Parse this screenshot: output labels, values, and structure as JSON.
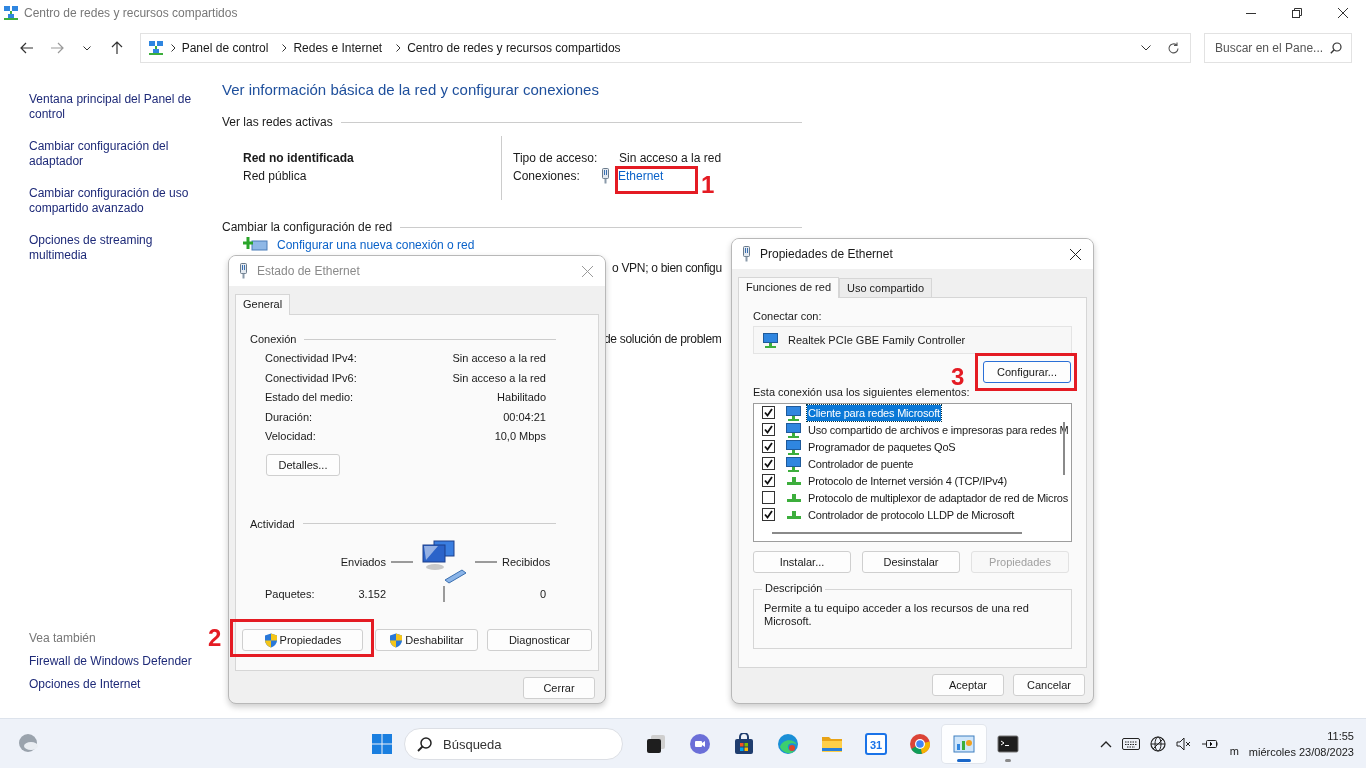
{
  "window": {
    "title": "Centro de redes y recursos compartidos"
  },
  "address_bar": {
    "breadcrumbs": [
      "Panel de control",
      "Redes e Internet",
      "Centro de redes y recursos compartidos"
    ]
  },
  "search": {
    "placeholder": "Buscar en el Pane..."
  },
  "sidebar": {
    "links": [
      "Ventana principal del Panel de control",
      "Cambiar configuración del adaptador",
      "Cambiar configuración de uso compartido avanzado",
      "Opciones de streaming multimedia"
    ],
    "see_also_title": "Vea también",
    "see_also": [
      "Firewall de Windows Defender",
      "Opciones de Internet"
    ]
  },
  "main": {
    "heading": "Ver información básica de la red y configurar conexiones",
    "active_networks_title": "Ver las redes activas",
    "network": {
      "name": "Red no identificada",
      "category": "Red pública",
      "access_label": "Tipo de acceso:",
      "access_value": "Sin acceso a la red",
      "connections_label": "Conexiones:",
      "connection_link": "Ethernet"
    },
    "change_title": "Cambiar la configuración de red",
    "setup_link": "Configurar una nueva conexión o red",
    "covered_fragments": [
      "o VPN; o bien configu",
      "de solución de problem"
    ]
  },
  "status_dialog": {
    "title": "Estado de Ethernet",
    "tabs": [
      {
        "label": "General",
        "selected": true
      }
    ],
    "connection_title": "Conexión",
    "rows": [
      {
        "label": "Conectividad IPv4:",
        "value": "Sin acceso a la red"
      },
      {
        "label": "Conectividad IPv6:",
        "value": "Sin acceso a la red"
      },
      {
        "label": "Estado del medio:",
        "value": "Habilitado"
      },
      {
        "label": "Duración:",
        "value": "00:04:21"
      },
      {
        "label": "Velocidad:",
        "value": "10,0 Mbps"
      }
    ],
    "details_button": "Detalles...",
    "activity_title": "Actividad",
    "sent_label": "Enviados",
    "received_label": "Recibidos",
    "packets_label": "Paquetes:",
    "packets_sent": "3.152",
    "packets_received": "0",
    "buttons": [
      {
        "label": "Propiedades",
        "shield": true
      },
      {
        "label": "Deshabilitar",
        "shield": true
      },
      {
        "label": "Diagnosticar",
        "shield": false
      }
    ],
    "close_button": "Cerrar"
  },
  "properties_dialog": {
    "title": "Propiedades de Ethernet",
    "tabs": [
      {
        "label": "Funciones de red",
        "selected": true
      },
      {
        "label": "Uso compartido",
        "selected": false
      }
    ],
    "connect_label": "Conectar con:",
    "adapter": "Realtek PCIe GBE Family Controller",
    "configure_button": "Configurar...",
    "components_label": "Esta conexión usa los siguientes elementos:",
    "components": [
      {
        "kind": "client",
        "label": "Cliente para redes Microsoft",
        "checked": true,
        "selected": true
      },
      {
        "kind": "service",
        "label": "Uso compartido de archivos e impresoras para redes M",
        "checked": true,
        "selected": false
      },
      {
        "kind": "service",
        "label": "Programador de paquetes QoS",
        "checked": true,
        "selected": false
      },
      {
        "kind": "service",
        "label": "Controlador de puente",
        "checked": true,
        "selected": false
      },
      {
        "kind": "protocol",
        "label": "Protocolo de Internet versión 4 (TCP/IPv4)",
        "checked": true,
        "selected": false
      },
      {
        "kind": "protocol",
        "label": "Protocolo de multiplexor de adaptador de red de Micros",
        "checked": false,
        "selected": false
      },
      {
        "kind": "protocol",
        "label": "Controlador de protocolo LLDP de Microsoft",
        "checked": true,
        "selected": false
      }
    ],
    "buttons": [
      {
        "label": "Instalar...",
        "disabled": false
      },
      {
        "label": "Desinstalar",
        "disabled": false
      },
      {
        "label": "Propiedades",
        "disabled": true
      }
    ],
    "description_title": "Descripción",
    "description": "Permite a tu equipo acceder a los recursos de una red Microsoft.",
    "ok_button": "Aceptar",
    "cancel_button": "Cancelar"
  },
  "annotations": [
    {
      "number": "1"
    },
    {
      "number": "2"
    },
    {
      "number": "3"
    }
  ],
  "taskbar": {
    "search_placeholder": "Búsqueda",
    "apps": [
      {
        "kind": "task-view",
        "running": false,
        "active": false
      },
      {
        "kind": "chat",
        "running": false,
        "active": false
      },
      {
        "kind": "store",
        "running": false,
        "active": false
      },
      {
        "kind": "edge",
        "running": false,
        "active": false
      },
      {
        "kind": "folder",
        "running": false,
        "active": false
      },
      {
        "kind": "calendar",
        "text": "31",
        "running": false,
        "active": false
      },
      {
        "kind": "chrome",
        "running": false,
        "active": false
      },
      {
        "kind": "control-panel",
        "running": true,
        "active": true
      },
      {
        "kind": "terminal",
        "running": true,
        "active": false
      }
    ],
    "input_indicator": "m",
    "time": "11:55",
    "date": "miércoles 23/08/2023"
  }
}
